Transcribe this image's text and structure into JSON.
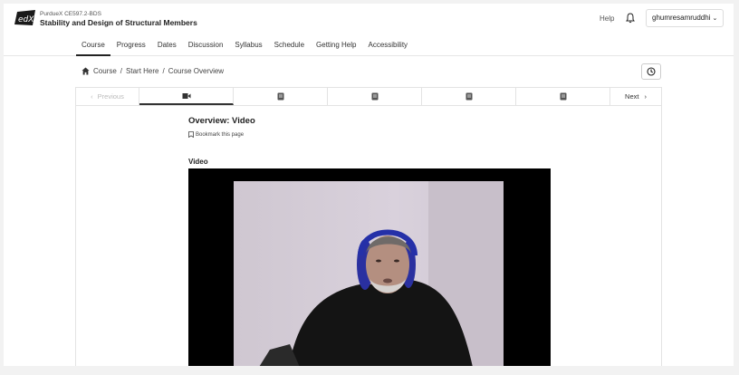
{
  "header": {
    "org": "PurdueX CE597.2-BDS",
    "course_title": "Stability and Design of Structural Members",
    "help_label": "Help",
    "username": "ghumresamruddhi",
    "user_chevron": "⌄"
  },
  "nav": {
    "tabs": [
      "Course",
      "Progress",
      "Dates",
      "Discussion",
      "Syllabus",
      "Schedule",
      "Getting Help",
      "Accessibility"
    ],
    "active_index": 0
  },
  "breadcrumb": {
    "items": [
      "Course",
      "Start Here",
      "Course Overview"
    ],
    "separator": "/"
  },
  "sequence": {
    "previous_label": "Previous",
    "next_label": "Next",
    "units": [
      {
        "icon": "video-icon",
        "active": true
      },
      {
        "icon": "document-icon",
        "active": false
      },
      {
        "icon": "document-icon",
        "active": false
      },
      {
        "icon": "document-icon",
        "active": false
      },
      {
        "icon": "document-icon",
        "active": false
      }
    ]
  },
  "content": {
    "title": "Overview: Video",
    "bookmark_label": "Bookmark this page",
    "video_label": "Video"
  },
  "colors": {
    "accent": "#222222",
    "muted": "#bbbbbb",
    "border": "#e3e3e3"
  }
}
